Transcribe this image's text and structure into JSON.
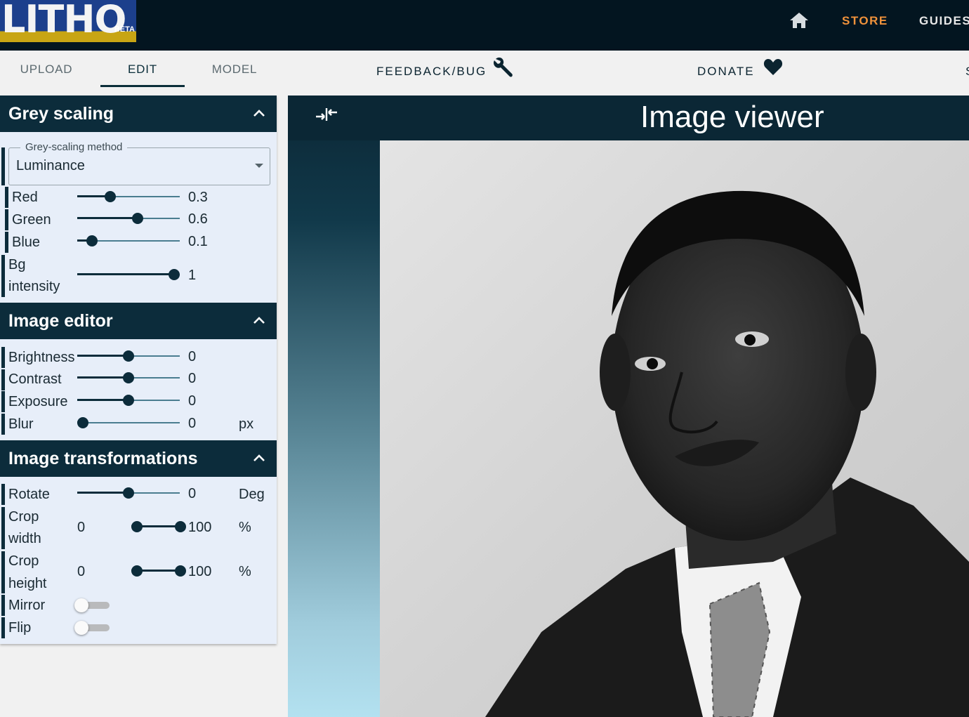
{
  "header": {
    "logo_text": "LITHO",
    "logo_badge": "BETA",
    "store_label": "STORE",
    "guides_label": "GUIDES"
  },
  "tabs": [
    {
      "label": "UPLOAD",
      "active": false
    },
    {
      "label": "EDIT",
      "active": true
    },
    {
      "label": "MODEL",
      "active": false
    }
  ],
  "toplinks": {
    "feedback_label": "FEEDBACK/BUG",
    "donate_label": "DONATE",
    "cut_label": "S"
  },
  "grey_scaling": {
    "title": "Grey scaling",
    "method_legend": "Grey-scaling method",
    "method_value": "Luminance",
    "red": {
      "label": "Red",
      "value": "0.3",
      "fraction": 0.3
    },
    "green": {
      "label": "Green",
      "value": "0.6",
      "fraction": 0.6
    },
    "blue": {
      "label": "Blue",
      "value": "0.1",
      "fraction": 0.1
    },
    "bg": {
      "label_line1": "Bg",
      "label_line2": "intensity",
      "value": "1",
      "fraction": 1.0
    }
  },
  "image_editor": {
    "title": "Image editor",
    "brightness": {
      "label": "Brightness",
      "value": "0",
      "fraction": 0.5
    },
    "contrast": {
      "label": "Contrast",
      "value": "0",
      "fraction": 0.5
    },
    "exposure": {
      "label": "Exposure",
      "value": "0",
      "fraction": 0.5
    },
    "blur": {
      "label": "Blur",
      "value": "0",
      "unit": "px",
      "fraction": 0.0
    }
  },
  "image_transformations": {
    "title": "Image transformations",
    "rotate": {
      "label": "Rotate",
      "value": "0",
      "unit": "Deg",
      "fraction": 0.5
    },
    "crop_width": {
      "label_line1": "Crop",
      "label_line2": "width",
      "min": "0",
      "max": "100",
      "unit": "%"
    },
    "crop_height": {
      "label_line1": "Crop",
      "label_line2": "height",
      "min": "0",
      "max": "100",
      "unit": "%"
    },
    "mirror": {
      "label": "Mirror",
      "on": false
    },
    "flip": {
      "label": "Flip",
      "on": false
    }
  },
  "viewer": {
    "title": "Image viewer"
  },
  "colors": {
    "nav_dark": "#031520",
    "panel_dark": "#0c2c3b",
    "store_orange": "#f0923b",
    "panel_bg": "#e7eef9"
  }
}
